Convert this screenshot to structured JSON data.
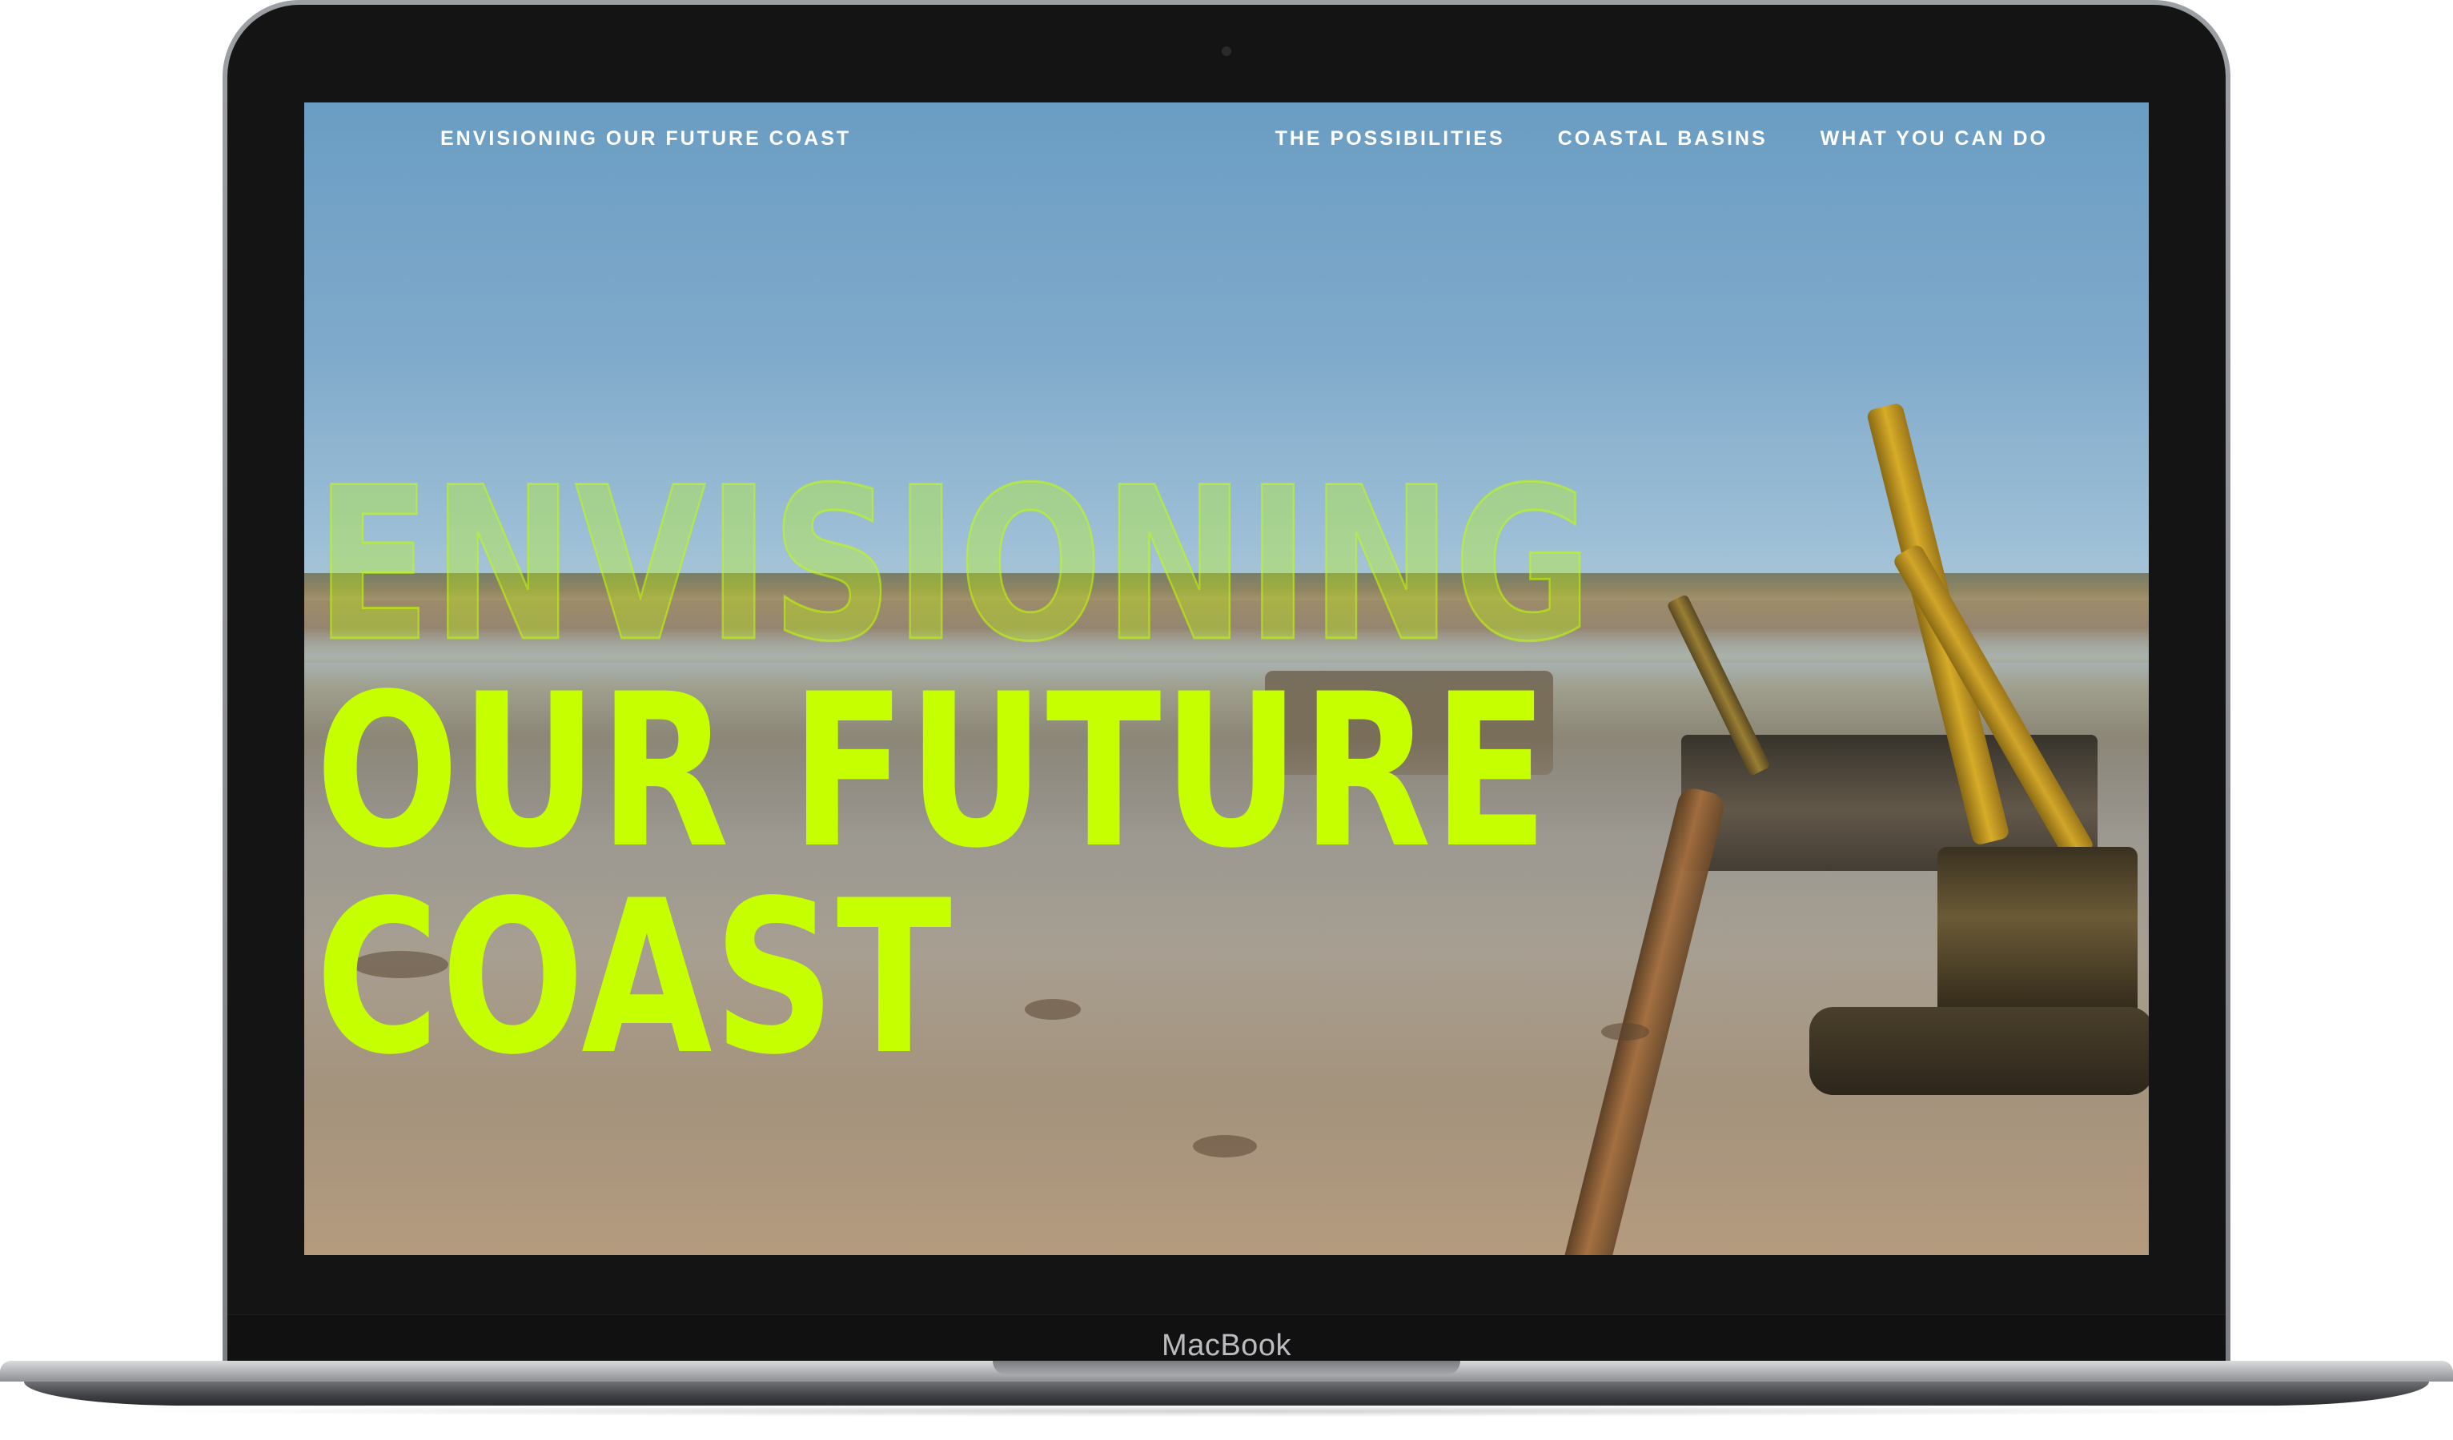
{
  "device": {
    "brand_label": "MacBook"
  },
  "header": {
    "site_title": "ENVISIONING OUR FUTURE COAST",
    "nav": [
      {
        "label": "THE POSSIBILITIES"
      },
      {
        "label": "COASTAL BASINS"
      },
      {
        "label": "WHAT YOU CAN DO"
      }
    ]
  },
  "hero": {
    "line1": "ENVISIONING",
    "line2": "OUR FUTURE",
    "line3": "COAST"
  },
  "colors": {
    "accent": "#c6ff00",
    "nav_text": "#ffffff",
    "bezel": "#141414"
  },
  "background": {
    "scene": "marsh-restoration-excavators-photo"
  }
}
